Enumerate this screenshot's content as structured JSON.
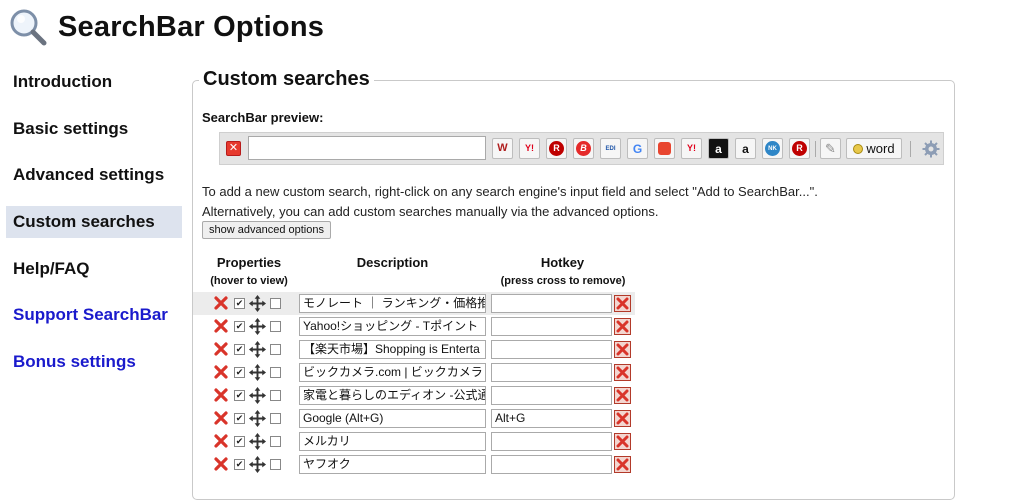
{
  "header": {
    "title": "SearchBar Options",
    "logo_icon": "magnifier-icon"
  },
  "sidebar": {
    "items": [
      {
        "label": "Introduction"
      },
      {
        "label": "Basic settings"
      },
      {
        "label": "Advanced settings"
      },
      {
        "label": "Custom searches",
        "active": true
      },
      {
        "label": "Help/FAQ"
      },
      {
        "label": "Support SearchBar",
        "link": true
      },
      {
        "label": "Bonus settings",
        "link": true
      }
    ],
    "active_bg": "#dde3ee",
    "link_color": "#1a1acc"
  },
  "panel": {
    "title": "Custom searches",
    "preview_label": "SearchBar preview:",
    "preview": {
      "query_value": "",
      "engines": [
        "wowma-icon",
        "yahoo-icon",
        "rakuten-icon",
        "b-icon",
        "edion-icon",
        "google-icon",
        "mercari-icon",
        "yahoo-auction-icon",
        "amazon-black-icon",
        "amazon-icon",
        "kakaku-icon",
        "rakuten-2-icon"
      ],
      "word_button_label": "word"
    },
    "info_line1": "To add a new custom search, right-click on any search engine's input field and select \"Add to SearchBar...\".",
    "info_line2": "Alternatively, you can add custom searches manually via the advanced options.",
    "advanced_button_label": "show advanced options",
    "table": {
      "headers": {
        "properties": "Properties",
        "properties_sub": "(hover to view)",
        "description": "Description",
        "hotkey": "Hotkey",
        "hotkey_sub": "(press cross to remove)"
      },
      "rows": [
        {
          "description": "モノレート ｜ ランキング・価格推",
          "hotkey": "",
          "enabled": true
        },
        {
          "description": "Yahoo!ショッピング - Tポイント",
          "hotkey": "",
          "enabled": true
        },
        {
          "description": "【楽天市場】Shopping is Enterta",
          "hotkey": "",
          "enabled": true
        },
        {
          "description": "ビックカメラ.com | ビックカメラ",
          "hotkey": "",
          "enabled": true
        },
        {
          "description": "家電と暮らしのエディオン -公式通",
          "hotkey": "",
          "enabled": true
        },
        {
          "description": "Google (Alt+G)",
          "hotkey": "Alt+G",
          "enabled": true
        },
        {
          "description": "メルカリ",
          "hotkey": "",
          "enabled": true
        },
        {
          "description": "ヤフオク",
          "hotkey": "",
          "enabled": true
        }
      ]
    }
  }
}
